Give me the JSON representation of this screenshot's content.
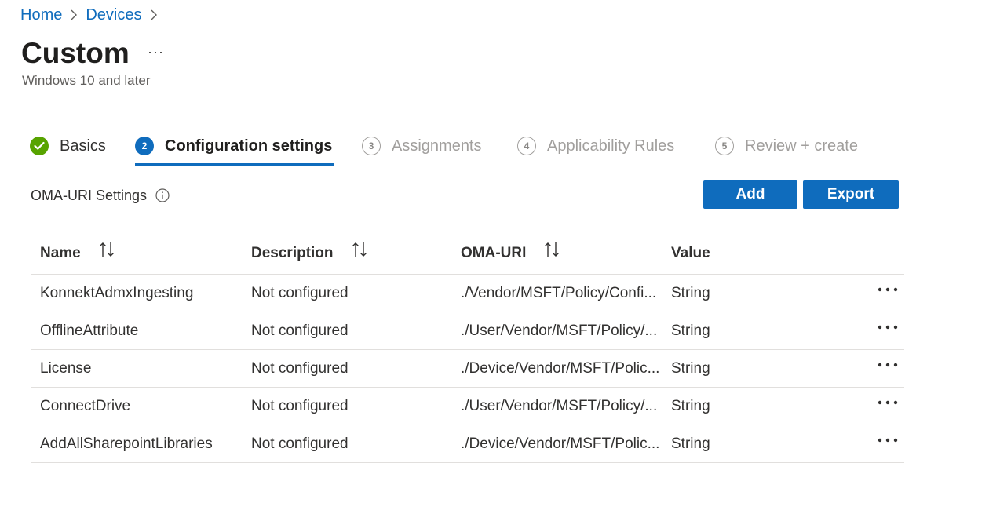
{
  "breadcrumb": {
    "home": "Home",
    "devices": "Devices"
  },
  "title": "Custom",
  "more_label": "···",
  "subtitle": "Windows 10 and later",
  "steps": [
    {
      "number": "",
      "label": "Basics",
      "state": "done"
    },
    {
      "number": "2",
      "label": "Configuration settings",
      "state": "current"
    },
    {
      "number": "3",
      "label": "Assignments",
      "state": "todo"
    },
    {
      "number": "4",
      "label": "Applicability Rules",
      "state": "todo"
    },
    {
      "number": "5",
      "label": "Review + create",
      "state": "todo"
    }
  ],
  "section": {
    "label": "OMA-URI Settings",
    "info_icon": "info-icon"
  },
  "buttons": {
    "add": "Add",
    "export": "Export"
  },
  "table": {
    "headers": {
      "name": "Name",
      "description": "Description",
      "oma_uri": "OMA-URI",
      "value": "Value"
    },
    "rows": [
      {
        "name": "KonnektAdmxIngesting",
        "description": "Not configured",
        "oma_uri": "./Vendor/MSFT/Policy/Confi...",
        "value": "String"
      },
      {
        "name": "OfflineAttribute",
        "description": "Not configured",
        "oma_uri": "./User/Vendor/MSFT/Policy/...",
        "value": "String"
      },
      {
        "name": "License",
        "description": "Not configured",
        "oma_uri": "./Device/Vendor/MSFT/Polic...",
        "value": "String"
      },
      {
        "name": "ConnectDrive",
        "description": "Not configured",
        "oma_uri": "./User/Vendor/MSFT/Policy/...",
        "value": "String"
      },
      {
        "name": "AddAllSharepointLibraries",
        "description": "Not configured",
        "oma_uri": "./Device/Vendor/MSFT/Polic...",
        "value": "String"
      }
    ]
  },
  "colors": {
    "accent": "#0f6cbd",
    "success": "#57a300",
    "muted": "#a19f9d"
  }
}
